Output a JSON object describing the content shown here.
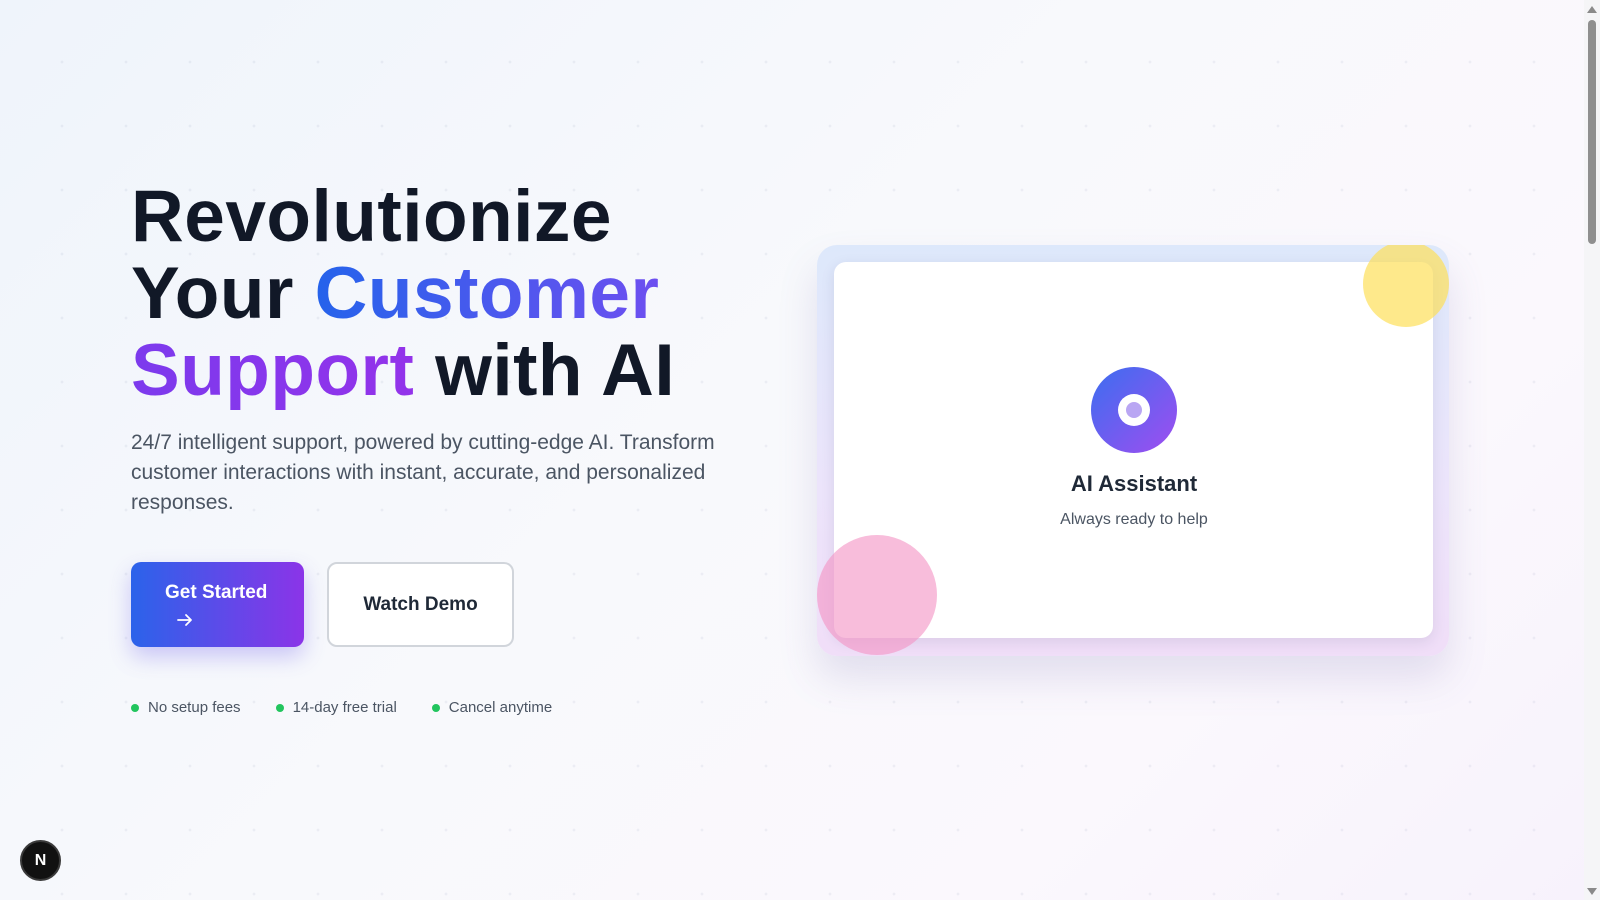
{
  "hero": {
    "title_line1": "Revolutionize",
    "title_line2_plain": "Your ",
    "title_line2_accent": "Customer",
    "title_line3_accent": "Support",
    "title_line3_plain": " with AI",
    "subtitle": "24/7 intelligent support, powered by cutting-edge AI. Transform customer interactions with instant, accurate, and personalized responses."
  },
  "actions": {
    "primary_label": "Get Started",
    "primary_icon": "arrow-right-icon",
    "secondary_label": "Watch Demo"
  },
  "features": [
    {
      "label": "No setup fees",
      "dot_color": "#22c55e"
    },
    {
      "label": "14-day free trial",
      "dot_color": "#22c55e"
    },
    {
      "label": "Cancel anytime",
      "dot_color": "#22c55e"
    }
  ],
  "assistant_card": {
    "title": "AI Assistant",
    "subtitle": "Always ready to help",
    "icon": "ai-assistant-icon"
  },
  "badge": {
    "label": "N"
  },
  "colors": {
    "brand_blue": "#2563eb",
    "brand_purple": "#9333ea",
    "text_dark": "#111827",
    "text_muted": "#4b5563",
    "feature_dot": "#22c55e",
    "accent_yellow": "#fde05a",
    "accent_pink": "#f495c5"
  }
}
